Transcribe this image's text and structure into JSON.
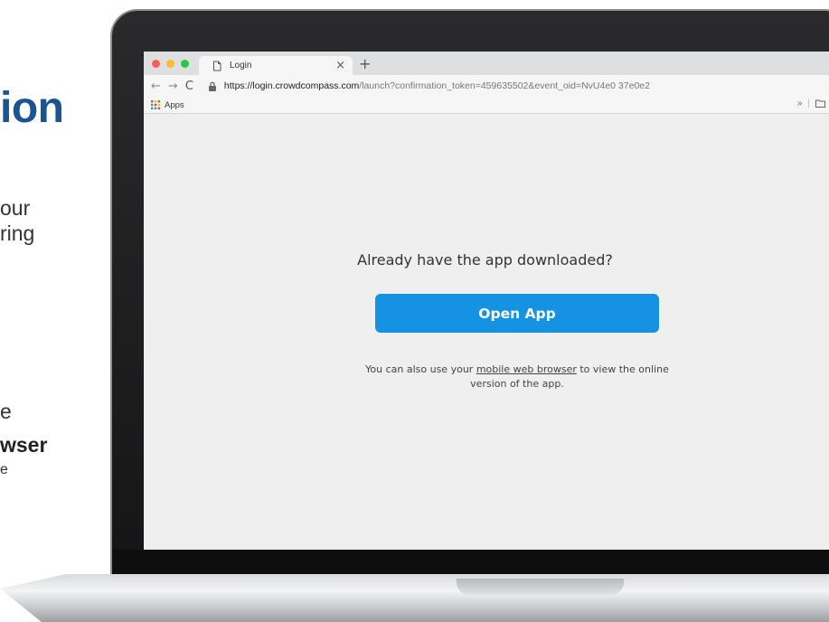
{
  "slide": {
    "title_fragment": "ion",
    "line1": "our",
    "line2": "ring",
    "line3": "e",
    "line4": "wser",
    "line5": "e"
  },
  "browser": {
    "tab_title": "Login",
    "tab_close": "×",
    "new_tab": "+",
    "url_domain": "https://login.crowdcompass.com",
    "url_path": "/launch?confirmation_token=459635502&event_oid=NvU4e0 37e0e2",
    "bookmarks_apps": "Apps",
    "bookmarks_more": "»",
    "colors": {
      "close": "#fc5e57",
      "minimize": "#fdbb2e",
      "maximize": "#28c840"
    }
  },
  "page": {
    "headline": "Already have the app downloaded?",
    "open_button": "Open App",
    "helper_prefix": "You can also use your ",
    "helper_link": "mobile web browser",
    "helper_suffix": " to view the online version of the app.",
    "button_color": "#1592e2"
  }
}
